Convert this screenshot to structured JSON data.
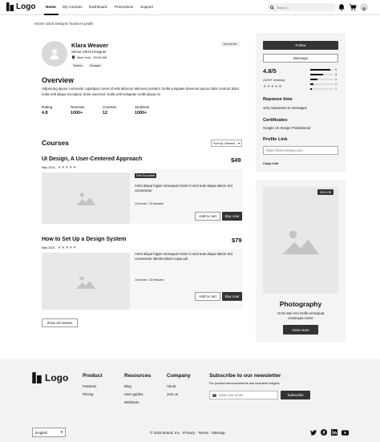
{
  "nav": {
    "logo": "Logo",
    "links": [
      "Home",
      "My Courses",
      "Dashboard",
      "Promotions",
      "Support"
    ],
    "search_placeholder": "Search..."
  },
  "breadcrumb": "Home/ UI/UX Designs/ Teacher's profile",
  "profile": {
    "name": "Klara Weaver",
    "title": "Senior UI/UX Designer",
    "location": "New York - 09:30 AM",
    "tags": [
      "Teacher",
      "Designer"
    ],
    "badge": "Top teacher"
  },
  "overview": {
    "heading": "Overview",
    "text": "Adipiscing ipsum commodo cupidatat Lorem id velit laborum laborum proident. Nulla voluptate deserunt ipsum dolor nostrud dolor nulla velit aliqua excepteur dolor eiusmod. Nulla velit voluptate mollit aliqua no",
    "stats": [
      {
        "label": "Rating",
        "value": "4.8"
      },
      {
        "label": "Reviews",
        "value": "1000+"
      },
      {
        "label": "Courses",
        "value": "12"
      },
      {
        "label": "Students",
        "value": "1000+"
      }
    ]
  },
  "courses": {
    "heading": "Courses",
    "sort_label": "Sort by: Newest",
    "items": [
      {
        "title": "UI Design, A User-Centered Approach",
        "price": "$49",
        "date": "May 2021",
        "badge": "Free Document",
        "desc": "Amet aliqua fugiat consequat minim in sunt aute aliqua labore sint consectetur",
        "meta": "14 hours / 12 lessons",
        "cart": "Add to cart",
        "buy": "Buy now"
      },
      {
        "title": "How to Set Up a Design System",
        "price": "$79",
        "date": "May 2021",
        "badge": "",
        "desc": "Amet aliqua fugiat consequat minim in sunt aute aliqua labore sint consectetur laboris labore culpa adi",
        "meta": "14 hours / 12 lessons",
        "cart": "Add to cart",
        "buy": "Buy now"
      }
    ],
    "show_all": "Show all courses"
  },
  "sidebar": {
    "follow": "Follow",
    "message": "Message",
    "rating": "4.8/5",
    "reviews": "(1000+ reviews)",
    "bars": [
      {
        "label": "5",
        "fill": 0.85
      },
      {
        "label": "4",
        "fill": 0.55
      },
      {
        "label": "3",
        "fill": 0.3
      },
      {
        "label": "2",
        "fill": 0.15
      },
      {
        "label": "1",
        "fill": 0.08
      }
    ],
    "response_title": "Reponse time",
    "response_text": "Very responsive to messages",
    "cert_title": "Certificates",
    "cert_text": "Google UX Design Professional",
    "link_title": "Profile Link",
    "link_value": "https://Klara-Design.com",
    "copy": "Copy Link"
  },
  "promo": {
    "discount": "30% Off",
    "title": "Photography",
    "text": "Ut sit aute non mollit consequat consequat conse",
    "button": "View more"
  },
  "footer": {
    "logo": "Logo",
    "cols": [
      {
        "title": "Product",
        "items": [
          "Features",
          "Pricing"
        ]
      },
      {
        "title": "Resources",
        "items": [
          "Blog",
          "User guides",
          "Webinars"
        ]
      },
      {
        "title": "Company",
        "items": [
          "About",
          "Join us"
        ]
      }
    ],
    "newsletter_title": "Subscribe to our newsletter",
    "newsletter_sub": "For product announcements and exclusive insights",
    "email_placeholder": "Input your email",
    "subscribe": "Subscribe",
    "language": "English",
    "copyright": "© 2022 Brand, Inc · Privacy · Terms · Sitemap"
  },
  "colors": {
    "accent": "#333333",
    "placeholder": "#e8e8e8",
    "footer_bg": "#f2f2f2"
  }
}
